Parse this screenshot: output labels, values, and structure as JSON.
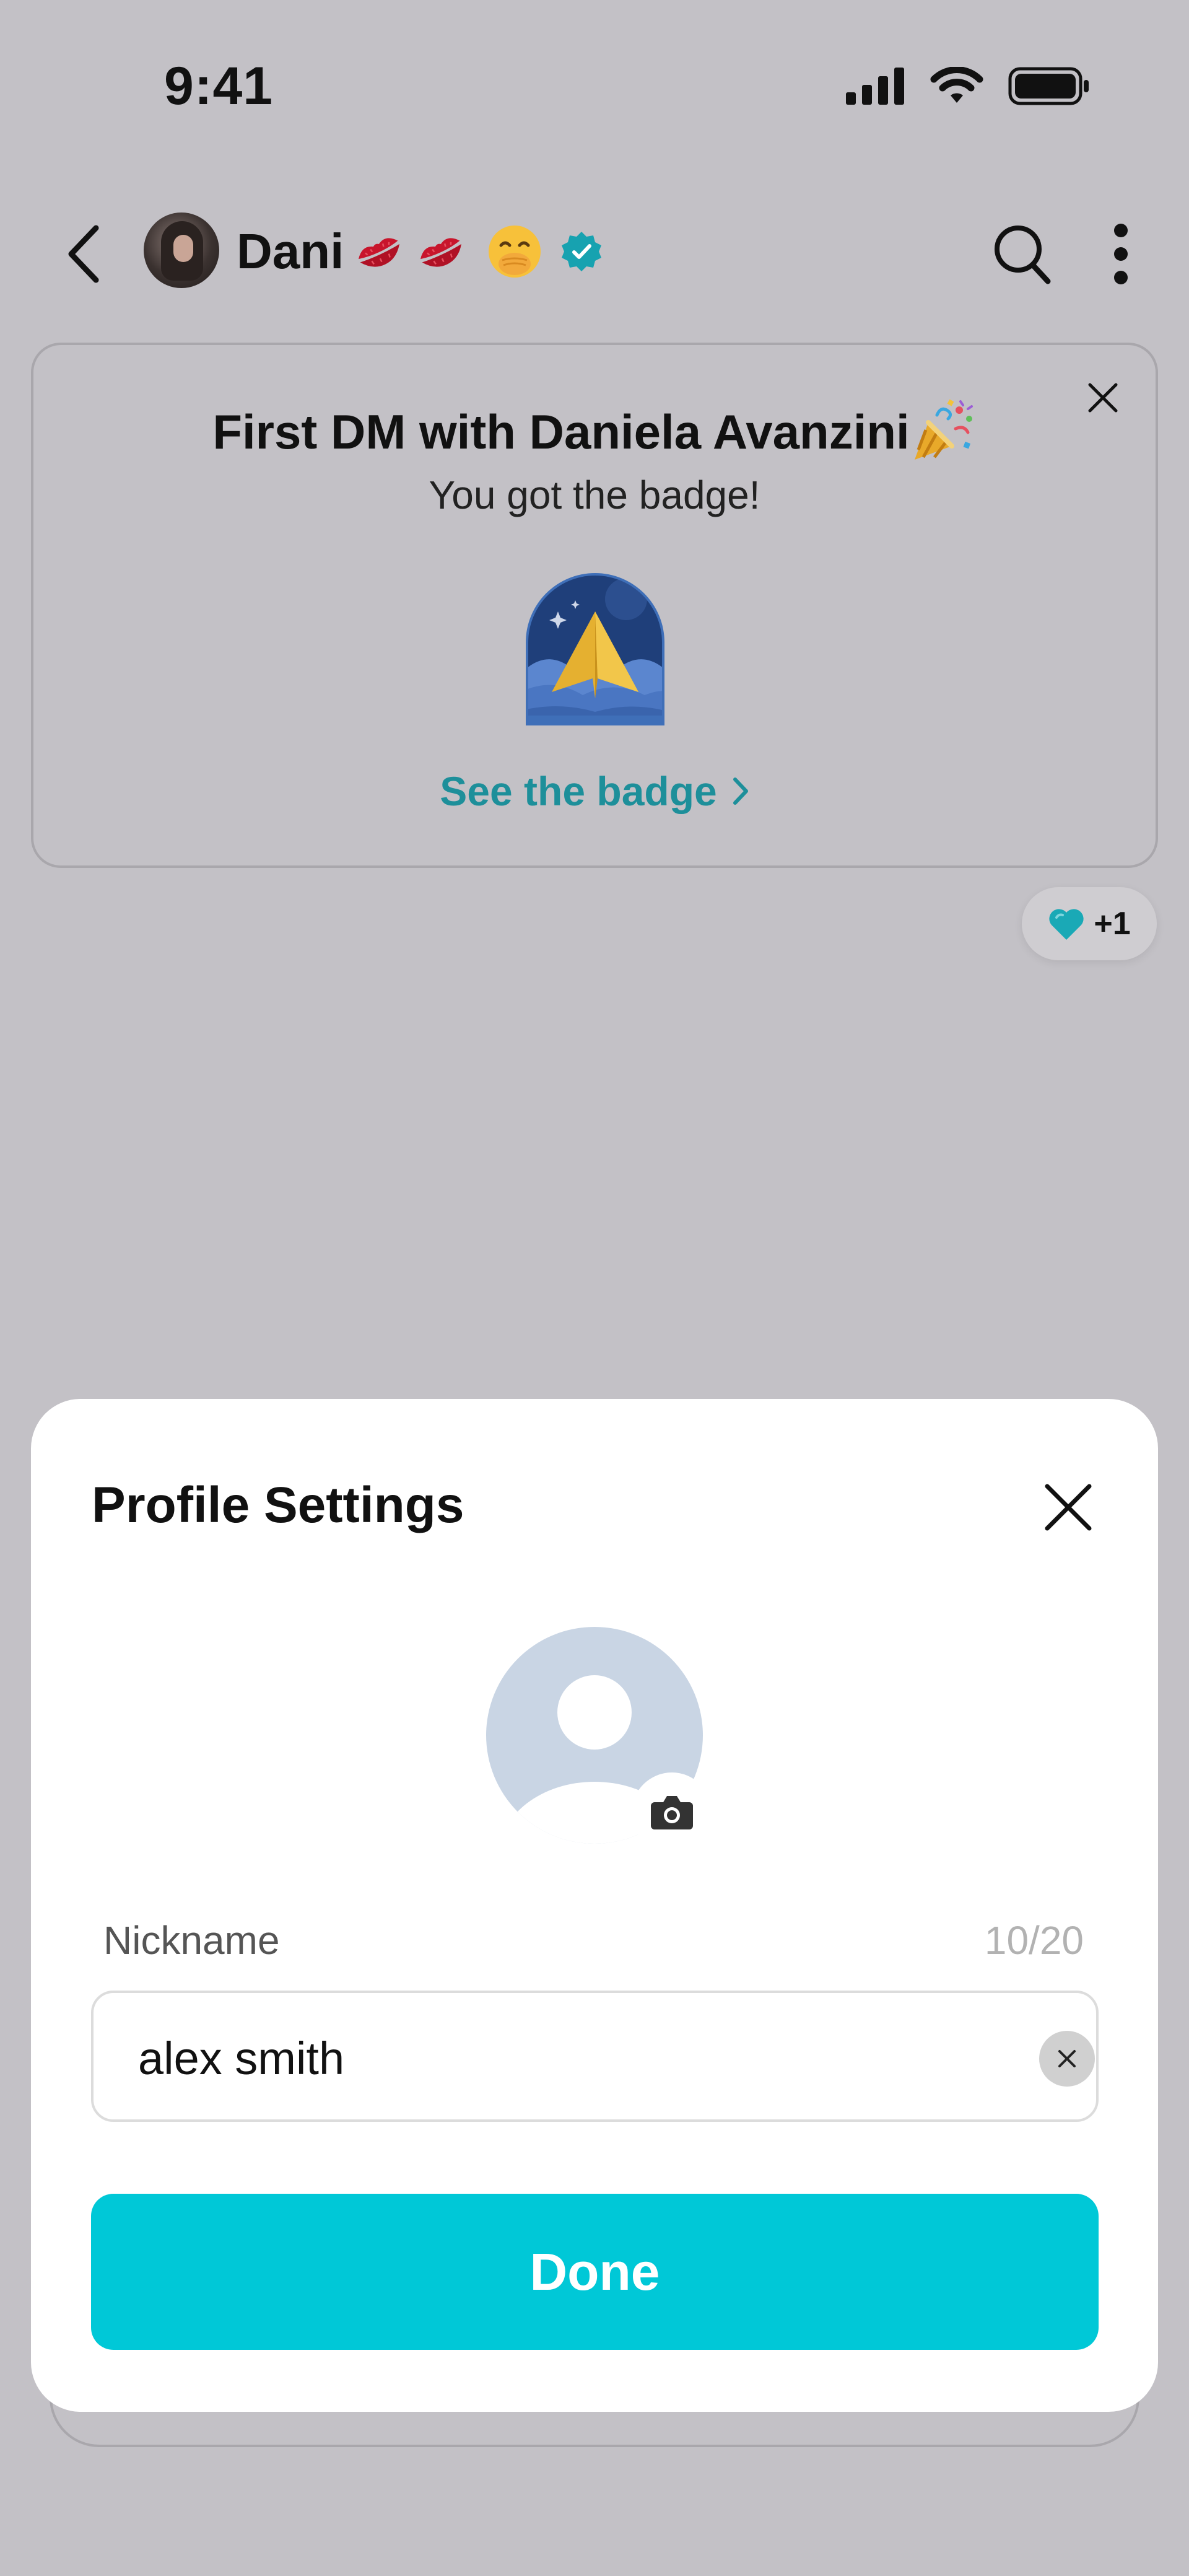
{
  "status_bar": {
    "time": "9:41",
    "icons": [
      "cellular-signal-icon",
      "wifi-icon",
      "battery-icon"
    ]
  },
  "header": {
    "contact_name": "Dani",
    "emojis": [
      "kiss-mark-emoji",
      "kiss-mark-emoji",
      "face-with-hand-over-mouth-emoji"
    ],
    "verified_color": "#17a2b0",
    "icons": [
      "back-chevron-icon",
      "search-icon",
      "more-vertical-icon"
    ]
  },
  "badge_card": {
    "title": "First DM with Daniela Avanzini",
    "subtitle": "You got the badge!",
    "link_text": "See the badge",
    "link_color": "#1d8f9a",
    "icons": [
      "close-icon",
      "party-popper-emoji",
      "paper-plane-badge-icon",
      "chevron-right-icon"
    ]
  },
  "reaction": {
    "emoji": "teal-heart-icon",
    "count": "+1"
  },
  "modal": {
    "title": "Profile Settings",
    "nickname_label": "Nickname",
    "nickname_count": "10/20",
    "nickname_value": "alex smith",
    "done_label": "Done",
    "accent_color": "#00c8d7",
    "icons": [
      "close-icon",
      "default-avatar-icon",
      "camera-icon",
      "clear-icon"
    ]
  }
}
